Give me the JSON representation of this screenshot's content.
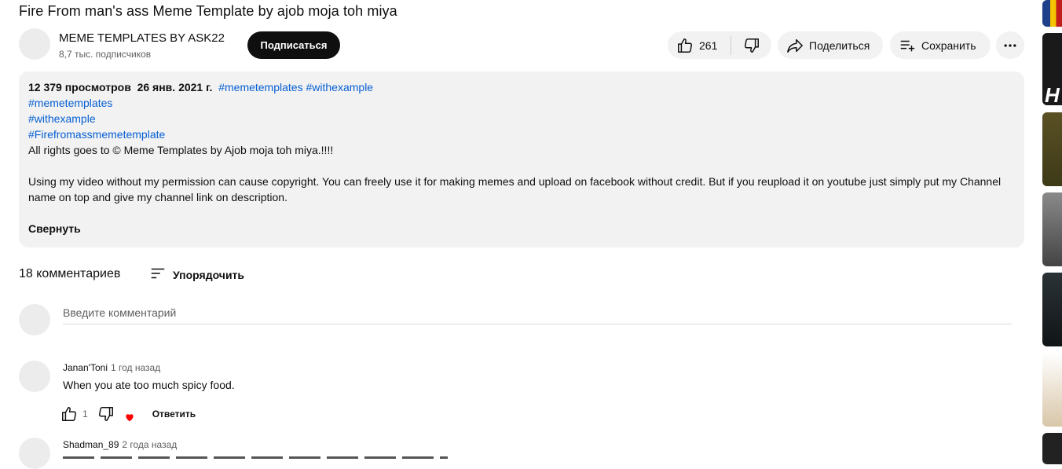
{
  "video": {
    "title": "Fire From man's ass Meme Template by ajob moja toh miya"
  },
  "channel": {
    "name": "MEME TEMPLATES BY ASK22",
    "subscribers": "8,7 тыс. подписчиков",
    "subscribe_label": "Подписаться"
  },
  "actions": {
    "likes": "261",
    "share_label": "Поделиться",
    "save_label": "Сохранить"
  },
  "description": {
    "views": "12 379 просмотров",
    "date": "26 янв. 2021 г.",
    "header_tags": [
      "#memetemplates",
      "#withexample"
    ],
    "tag_lines": [
      "#memetemplates",
      "#withexample",
      "#Firefromassmemetemplate"
    ],
    "rights": "All rights goes to © Meme Templates by Ajob moja toh miya.!!!!",
    "body": "Using my video without my permission can cause copyright. You can freely use it for making memes and upload on facebook without credit. But if you reupload it on youtube just simply put my Channel name on top and give my channel link on description.",
    "collapse_label": "Свернуть"
  },
  "comments": {
    "count_label": "18 комментариев",
    "sort_label": "Упорядочить",
    "input_placeholder": "Введите комментарий",
    "items": [
      {
        "author": "Janan'Toni",
        "time": "1 год назад",
        "text": "When you ate too much spicy food.",
        "likes": "1",
        "reply_label": "Ответить"
      },
      {
        "author": "Shadman_89",
        "time": "2 года назад"
      }
    ]
  },
  "colors": {
    "link": "#065fd4",
    "heart": "#ff0000",
    "pill_bg": "#f2f2f2",
    "subscribe_bg": "#0f0f0f"
  }
}
